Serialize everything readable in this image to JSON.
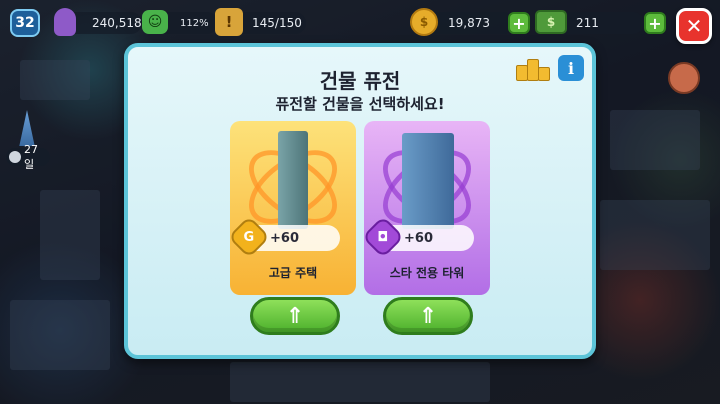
{
  "hud": {
    "level": "32",
    "population": "240,518",
    "happiness": "112%",
    "storage": "145/150",
    "coins": "19,873",
    "cash": "211",
    "plus_label": "+",
    "close_label": "✕"
  },
  "side": {
    "timer_label": "27일"
  },
  "modal": {
    "title": "건물 퓨전",
    "subtitle": "퓨전할 건물을 선택하세요!",
    "info_label": "i",
    "cards": [
      {
        "name": "고급 주택",
        "bonus": "+60",
        "bonus_icon": "coin-g-icon",
        "bonus_glyph": "G",
        "color_top": "#fde27a",
        "color_bottom": "#f8b234"
      },
      {
        "name": "스타 전용 타워",
        "bonus": "+60",
        "bonus_icon": "camera-icon",
        "bonus_glyph": "◘",
        "color_top": "#e8b5f6",
        "color_bottom": "#b26ee6"
      }
    ],
    "fuse_button_glyph": "⇑"
  }
}
